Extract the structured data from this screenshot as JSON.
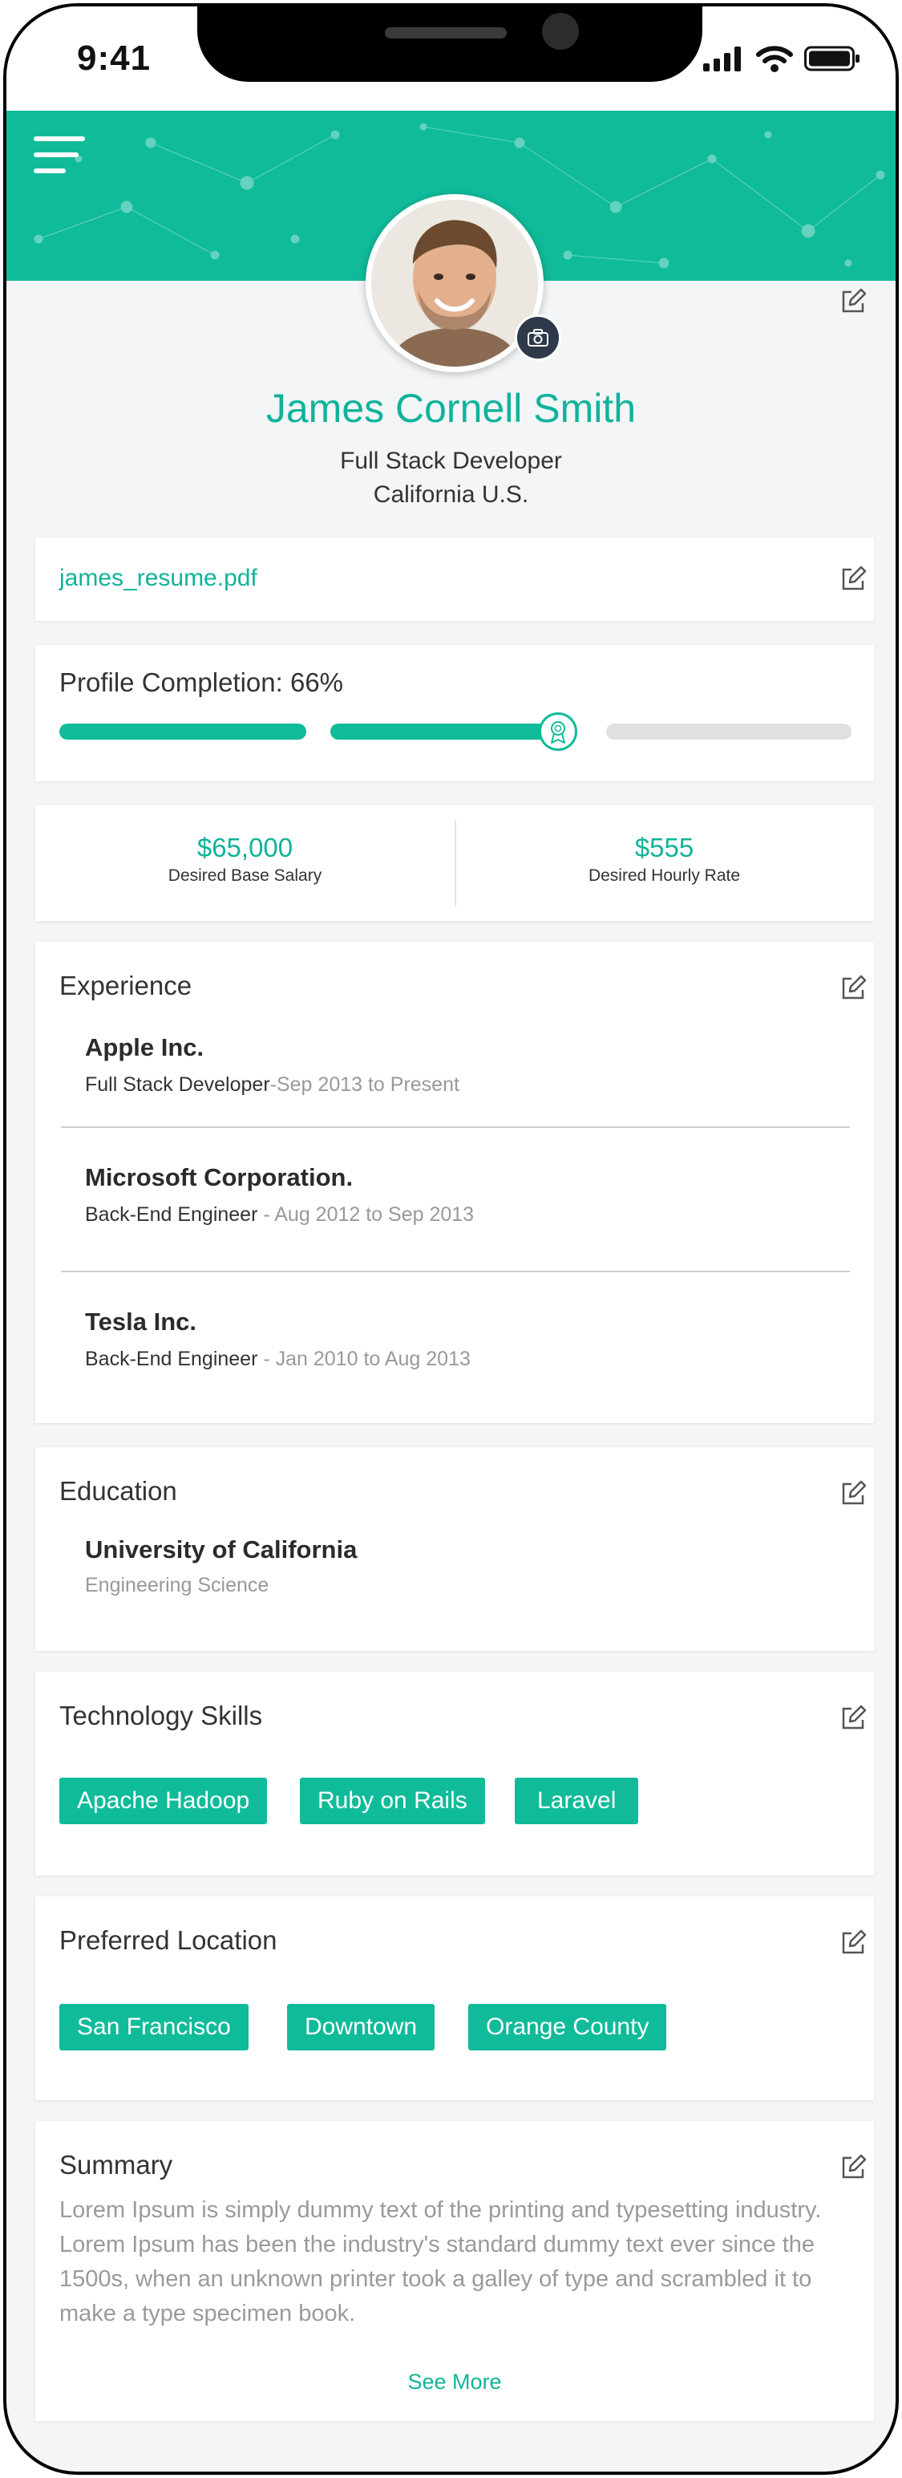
{
  "status_bar": {
    "time": "9:41"
  },
  "profile": {
    "name": "James Cornell Smith",
    "title": "Full Stack Developer",
    "location": "California U.S."
  },
  "resume": {
    "file_name": "james_resume.pdf"
  },
  "profile_completion": {
    "label": "Profile Completion:",
    "value_text": "66%",
    "value": 0.66
  },
  "stats": [
    {
      "value": "$65,000",
      "label": "Desired Base Salary"
    },
    {
      "value": "$555",
      "label": "Desired Hourly Rate"
    }
  ],
  "experience": {
    "title": "Experience",
    "items": [
      {
        "company": "Apple Inc.",
        "role": "Full Stack Developer",
        "dates": "-Sep 2013 to Present"
      },
      {
        "company": "Microsoft Corporation.",
        "role": "Back-End Engineer",
        "dates": " - Aug 2012 to Sep 2013"
      },
      {
        "company": "Tesla Inc.",
        "role": "Back-End Engineer",
        "dates": " - Jan 2010 to Aug 2013"
      }
    ]
  },
  "education": {
    "title": "Education",
    "school": "University of California",
    "field": "Engineering Science"
  },
  "skills": {
    "title": "Technology Skills",
    "chips": [
      "Apache Hadoop",
      "Ruby on Rails",
      "Laravel"
    ]
  },
  "locations": {
    "title": "Preferred Location",
    "chips": [
      "San Francisco",
      "Downtown",
      "Orange County"
    ]
  },
  "summary": {
    "title": "Summary",
    "text": "Lorem Ipsum is simply dummy text of the printing and typesetting industry. Lorem Ipsum has been the industry's standard dummy text ever since the 1500s, when an unknown printer took a galley of type and scrambled it to make a type specimen book.",
    "see_more": "See More"
  },
  "colors": {
    "accent": "#10bb9a",
    "text": "#333333",
    "muted": "#999999"
  },
  "icons": [
    "menu-icon",
    "camera-icon",
    "edit-icon",
    "medal-icon",
    "signal-icon",
    "wifi-icon",
    "battery-icon"
  ]
}
